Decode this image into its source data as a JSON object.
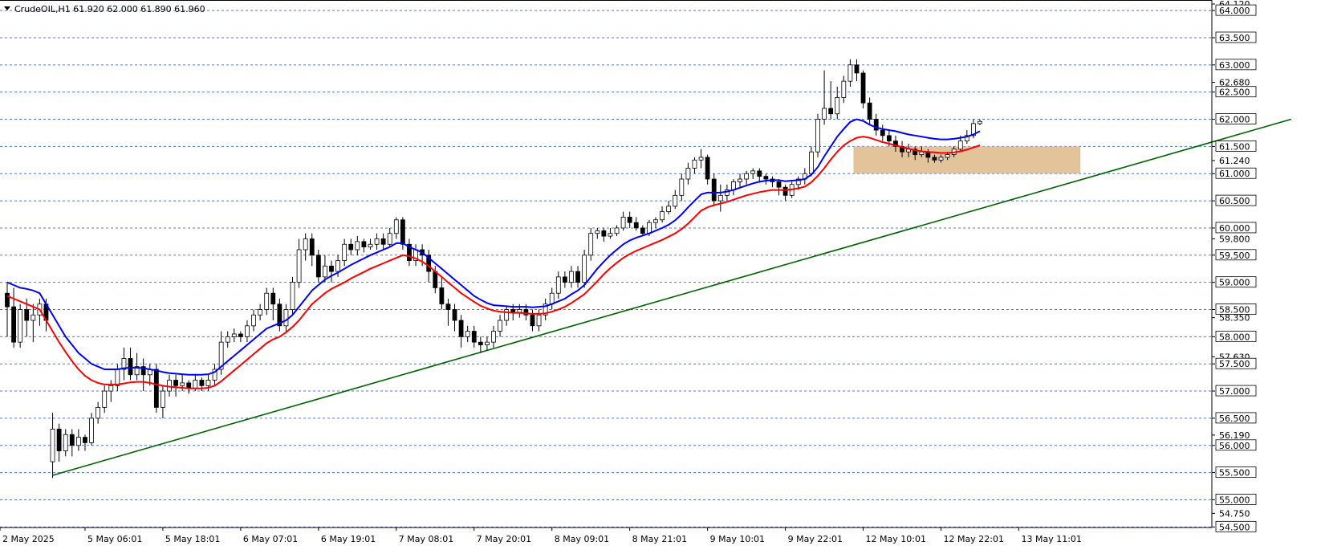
{
  "chart_title": "CrudeOIL,H1  61.920 62.000 61.890 61.960",
  "colors": {
    "background": "#ffffff",
    "axis": "#000000",
    "grid_dashed": "#3b5fc7",
    "candle_up_fill": "#ffffff",
    "candle_down_fill": "#000000",
    "ma_fast": "#0000ff",
    "ma_slow": "#ff0000",
    "trendline": "#006400",
    "zone": "#deb887"
  },
  "chart_data": {
    "type": "candlestick",
    "instrument": "CrudeOIL",
    "timeframe": "H1",
    "ohlc_last": {
      "open": 61.92,
      "high": 62.0,
      "low": 61.89,
      "close": 61.96
    },
    "ylim": [
      54.49,
      64.12
    ],
    "y_ticks": [
      {
        "label": "64.120",
        "value": 64.12
      },
      {
        "label": "64.000",
        "value": 64.0
      },
      {
        "label": "63.500",
        "value": 63.5
      },
      {
        "label": "63.000",
        "value": 63.0
      },
      {
        "label": "62.680",
        "value": 62.68
      },
      {
        "label": "62.500",
        "value": 62.5
      },
      {
        "label": "62.000",
        "value": 62.0
      },
      {
        "label": "61.500",
        "value": 61.5
      },
      {
        "label": "61.240",
        "value": 61.24
      },
      {
        "label": "61.000",
        "value": 61.0
      },
      {
        "label": "60.500",
        "value": 60.5
      },
      {
        "label": "60.000",
        "value": 60.0
      },
      {
        "label": "59.800",
        "value": 59.8
      },
      {
        "label": "59.500",
        "value": 59.5
      },
      {
        "label": "59.000",
        "value": 59.0
      },
      {
        "label": "58.500",
        "value": 58.5
      },
      {
        "label": "58.350",
        "value": 58.35
      },
      {
        "label": "58.000",
        "value": 58.0
      },
      {
        "label": "57.630",
        "value": 57.63
      },
      {
        "label": "57.500",
        "value": 57.5
      },
      {
        "label": "57.000",
        "value": 57.0
      },
      {
        "label": "56.500",
        "value": 56.5
      },
      {
        "label": "56.190",
        "value": 56.19
      },
      {
        "label": "56.000",
        "value": 56.0
      },
      {
        "label": "55.500",
        "value": 55.5
      },
      {
        "label": "55.000",
        "value": 55.0
      },
      {
        "label": "54.750",
        "value": 54.75
      },
      {
        "label": "54.500",
        "value": 54.5
      }
    ],
    "boxed_levels": [
      64.0,
      63.5,
      63.0,
      62.5,
      62.0,
      61.5,
      61.0,
      60.5,
      60.0,
      59.5,
      59.0,
      58.5,
      58.0,
      57.5,
      57.0,
      56.5,
      56.0,
      55.5,
      55.0,
      54.5
    ],
    "x_ticks": [
      {
        "label": "2 May 2025",
        "bar": 0
      },
      {
        "label": "5 May 06:01",
        "bar": 12
      },
      {
        "label": "5 May 18:01",
        "bar": 24
      },
      {
        "label": "6 May 07:01",
        "bar": 36
      },
      {
        "label": "6 May 19:01",
        "bar": 48
      },
      {
        "label": "7 May 08:01",
        "bar": 60
      },
      {
        "label": "7 May 20:01",
        "bar": 72
      },
      {
        "label": "8 May 09:01",
        "bar": 84
      },
      {
        "label": "8 May 21:01",
        "bar": 96
      },
      {
        "label": "9 May 10:01",
        "bar": 108
      },
      {
        "label": "9 May 22:01",
        "bar": 120
      },
      {
        "label": "12 May 10:01",
        "bar": 132
      },
      {
        "label": "12 May 22:01",
        "bar": 144
      },
      {
        "label": "13 May 11:01",
        "bar": 156
      }
    ],
    "candles": [
      [
        58.8,
        58.55,
        59.0,
        58.0
      ],
      [
        58.55,
        57.9,
        58.9,
        57.8
      ],
      [
        57.9,
        58.5,
        58.6,
        57.8
      ],
      [
        58.5,
        58.3,
        58.7,
        58.0
      ],
      [
        58.3,
        58.4,
        58.6,
        57.9
      ],
      [
        58.4,
        58.6,
        58.7,
        58.2
      ],
      [
        58.6,
        58.3,
        58.7,
        58.1
      ],
      [
        55.7,
        56.3,
        56.6,
        55.4
      ],
      [
        56.3,
        55.9,
        56.4,
        55.7
      ],
      [
        55.9,
        56.2,
        56.3,
        55.8
      ],
      [
        56.2,
        56.0,
        56.3,
        55.8
      ],
      [
        56.0,
        56.15,
        56.3,
        55.9
      ],
      [
        56.15,
        56.05,
        56.2,
        55.9
      ],
      [
        56.05,
        56.5,
        56.6,
        56.0
      ],
      [
        56.5,
        56.7,
        56.8,
        56.4
      ],
      [
        56.7,
        57.0,
        57.1,
        56.6
      ],
      [
        57.0,
        57.1,
        57.2,
        56.8
      ],
      [
        57.1,
        57.4,
        57.5,
        57.0
      ],
      [
        57.4,
        57.6,
        57.8,
        57.2
      ],
      [
        57.6,
        57.3,
        57.8,
        57.2
      ],
      [
        57.3,
        57.45,
        57.7,
        57.2
      ],
      [
        57.45,
        57.3,
        57.6,
        57.0
      ],
      [
        57.3,
        57.4,
        57.5,
        57.1
      ],
      [
        57.4,
        56.7,
        57.5,
        56.6
      ],
      [
        56.7,
        57.0,
        57.1,
        56.5
      ],
      [
        57.0,
        57.2,
        57.3,
        56.9
      ],
      [
        57.2,
        57.1,
        57.3,
        56.9
      ],
      [
        57.1,
        57.15,
        57.3,
        57.0
      ],
      [
        57.15,
        57.05,
        57.2,
        56.95
      ],
      [
        57.05,
        57.2,
        57.3,
        57.0
      ],
      [
        57.2,
        57.1,
        57.25,
        57.0
      ],
      [
        57.1,
        57.2,
        57.3,
        57.0
      ],
      [
        57.2,
        57.4,
        57.5,
        57.1
      ],
      [
        57.4,
        57.9,
        58.1,
        57.3
      ],
      [
        57.9,
        58.0,
        58.1,
        57.8
      ],
      [
        58.0,
        58.05,
        58.15,
        57.9
      ],
      [
        58.05,
        58.0,
        58.1,
        57.9
      ],
      [
        58.0,
        58.2,
        58.3,
        57.9
      ],
      [
        58.2,
        58.4,
        58.5,
        58.1
      ],
      [
        58.4,
        58.5,
        58.6,
        58.3
      ],
      [
        58.5,
        58.8,
        58.9,
        58.4
      ],
      [
        58.8,
        58.6,
        58.9,
        58.3
      ],
      [
        58.6,
        58.2,
        58.7,
        58.1
      ],
      [
        58.2,
        58.5,
        58.6,
        58.1
      ],
      [
        58.5,
        59.0,
        59.1,
        58.4
      ],
      [
        59.0,
        59.6,
        59.8,
        58.9
      ],
      [
        59.6,
        59.8,
        59.9,
        59.4
      ],
      [
        59.8,
        59.5,
        59.9,
        59.3
      ],
      [
        59.5,
        59.1,
        59.6,
        59.0
      ],
      [
        59.1,
        59.3,
        59.5,
        59.0
      ],
      [
        59.3,
        59.2,
        59.4,
        59.0
      ],
      [
        59.2,
        59.4,
        59.5,
        59.1
      ],
      [
        59.4,
        59.7,
        59.8,
        59.3
      ],
      [
        59.7,
        59.6,
        59.8,
        59.5
      ],
      [
        59.6,
        59.75,
        59.85,
        59.5
      ],
      [
        59.75,
        59.65,
        59.8,
        59.55
      ],
      [
        59.65,
        59.7,
        59.8,
        59.6
      ],
      [
        59.7,
        59.8,
        59.9,
        59.6
      ],
      [
        59.8,
        59.7,
        59.9,
        59.6
      ],
      [
        59.7,
        59.9,
        60.0,
        59.65
      ],
      [
        59.9,
        60.15,
        60.2,
        59.8
      ],
      [
        60.15,
        59.7,
        60.2,
        59.6
      ],
      [
        59.7,
        59.4,
        59.8,
        59.3
      ],
      [
        59.4,
        59.6,
        59.7,
        59.3
      ],
      [
        59.6,
        59.5,
        59.7,
        59.3
      ],
      [
        59.5,
        59.2,
        59.6,
        59.0
      ],
      [
        59.2,
        58.9,
        59.3,
        58.8
      ],
      [
        58.9,
        58.6,
        59.1,
        58.5
      ],
      [
        58.6,
        58.5,
        58.7,
        58.2
      ],
      [
        58.5,
        58.3,
        58.6,
        58.1
      ],
      [
        58.3,
        58.0,
        58.4,
        57.8
      ],
      [
        58.0,
        58.1,
        58.2,
        57.9
      ],
      [
        58.1,
        57.9,
        58.2,
        57.8
      ],
      [
        57.9,
        57.85,
        58.0,
        57.7
      ],
      [
        57.85,
        57.9,
        58.0,
        57.75
      ],
      [
        57.9,
        58.1,
        58.2,
        57.8
      ],
      [
        58.1,
        58.3,
        58.4,
        58.0
      ],
      [
        58.3,
        58.5,
        58.55,
        58.2
      ],
      [
        58.5,
        58.45,
        58.6,
        58.3
      ],
      [
        58.45,
        58.5,
        58.6,
        58.35
      ],
      [
        58.5,
        58.4,
        58.6,
        58.3
      ],
      [
        58.4,
        58.2,
        58.5,
        58.1
      ],
      [
        58.2,
        58.4,
        58.5,
        58.1
      ],
      [
        58.4,
        58.6,
        58.7,
        58.3
      ],
      [
        58.6,
        58.8,
        58.9,
        58.5
      ],
      [
        58.8,
        59.1,
        59.2,
        58.7
      ],
      [
        59.1,
        59.0,
        59.2,
        58.9
      ],
      [
        59.0,
        59.2,
        59.3,
        58.9
      ],
      [
        59.2,
        59.0,
        59.3,
        58.9
      ],
      [
        59.0,
        59.5,
        59.6,
        58.9
      ],
      [
        59.5,
        59.9,
        60.0,
        59.4
      ],
      [
        59.9,
        59.95,
        60.0,
        59.8
      ],
      [
        59.95,
        59.85,
        60.0,
        59.75
      ],
      [
        59.85,
        59.9,
        60.0,
        59.8
      ],
      [
        59.9,
        60.0,
        60.05,
        59.85
      ],
      [
        60.0,
        60.2,
        60.3,
        59.95
      ],
      [
        60.2,
        60.1,
        60.3,
        60.0
      ],
      [
        60.1,
        60.0,
        60.2,
        59.95
      ],
      [
        60.0,
        59.9,
        60.05,
        59.85
      ],
      [
        59.9,
        60.1,
        60.15,
        59.85
      ],
      [
        60.1,
        60.15,
        60.2,
        60.0
      ],
      [
        60.15,
        60.3,
        60.4,
        60.1
      ],
      [
        60.3,
        60.4,
        60.5,
        60.25
      ],
      [
        60.4,
        60.6,
        60.7,
        60.35
      ],
      [
        60.6,
        60.9,
        61.0,
        60.5
      ],
      [
        60.9,
        61.1,
        61.2,
        60.8
      ],
      [
        61.1,
        61.25,
        61.3,
        61.0
      ],
      [
        61.25,
        61.3,
        61.45,
        61.1
      ],
      [
        61.3,
        60.9,
        61.35,
        60.8
      ],
      [
        60.9,
        60.5,
        61.0,
        60.4
      ],
      [
        60.5,
        60.6,
        60.8,
        60.3
      ],
      [
        60.6,
        60.7,
        60.8,
        60.5
      ],
      [
        60.7,
        60.85,
        60.9,
        60.6
      ],
      [
        60.85,
        60.9,
        61.0,
        60.75
      ],
      [
        60.9,
        61.0,
        61.05,
        60.8
      ],
      [
        61.0,
        61.05,
        61.1,
        60.9
      ],
      [
        61.05,
        60.95,
        61.1,
        60.85
      ],
      [
        60.95,
        60.9,
        61.0,
        60.8
      ],
      [
        60.9,
        60.85,
        60.95,
        60.75
      ],
      [
        60.85,
        60.75,
        60.9,
        60.6
      ],
      [
        60.75,
        60.6,
        60.8,
        60.5
      ],
      [
        60.6,
        60.8,
        60.85,
        60.55
      ],
      [
        60.8,
        60.9,
        60.95,
        60.7
      ],
      [
        60.9,
        61.0,
        61.1,
        60.8
      ],
      [
        61.0,
        61.4,
        61.5,
        60.95
      ],
      [
        61.4,
        62.0,
        62.1,
        61.3
      ],
      [
        62.0,
        62.2,
        62.9,
        61.9
      ],
      [
        62.2,
        62.1,
        62.7,
        62.0
      ],
      [
        62.1,
        62.4,
        62.6,
        62.0
      ],
      [
        62.4,
        62.7,
        62.8,
        62.3
      ],
      [
        62.7,
        63.0,
        63.1,
        62.6
      ],
      [
        63.0,
        62.85,
        63.1,
        62.7
      ],
      [
        62.85,
        62.3,
        62.9,
        62.2
      ],
      [
        62.3,
        62.0,
        62.4,
        61.9
      ],
      [
        62.0,
        61.8,
        62.1,
        61.7
      ],
      [
        61.8,
        61.7,
        61.9,
        61.6
      ],
      [
        61.7,
        61.6,
        61.8,
        61.5
      ],
      [
        61.6,
        61.5,
        61.7,
        61.4
      ],
      [
        61.5,
        61.4,
        61.6,
        61.3
      ],
      [
        61.4,
        61.45,
        61.55,
        61.3
      ],
      [
        61.45,
        61.35,
        61.5,
        61.25
      ],
      [
        61.35,
        61.4,
        61.5,
        61.3
      ],
      [
        61.4,
        61.3,
        61.45,
        61.2
      ],
      [
        61.3,
        61.25,
        61.35,
        61.2
      ],
      [
        61.25,
        61.3,
        61.35,
        61.2
      ],
      [
        61.3,
        61.35,
        61.4,
        61.25
      ],
      [
        61.35,
        61.45,
        61.5,
        61.3
      ],
      [
        61.45,
        61.6,
        61.7,
        61.4
      ],
      [
        61.6,
        61.7,
        61.8,
        61.55
      ],
      [
        61.7,
        61.92,
        62.0,
        61.65
      ],
      [
        61.92,
        61.96,
        62.0,
        61.89
      ]
    ],
    "ma_fast_values": [
      59.0,
      58.95,
      58.9,
      58.88,
      58.85,
      58.8,
      58.6,
      58.4,
      58.2,
      58.0,
      57.85,
      57.7,
      57.6,
      57.5,
      57.45,
      57.4,
      57.4,
      57.4,
      57.42,
      57.43,
      57.43,
      57.42,
      57.4,
      57.38,
      57.35,
      57.33,
      57.32,
      57.31,
      57.3,
      57.3,
      57.3,
      57.31,
      57.35,
      57.45,
      57.55,
      57.65,
      57.75,
      57.85,
      57.95,
      58.05,
      58.15,
      58.2,
      58.25,
      58.3,
      58.4,
      58.55,
      58.7,
      58.85,
      58.95,
      59.05,
      59.12,
      59.18,
      59.25,
      59.32,
      59.38,
      59.44,
      59.5,
      59.55,
      59.6,
      59.65,
      59.72,
      59.72,
      59.65,
      59.6,
      59.55,
      59.45,
      59.35,
      59.25,
      59.15,
      59.05,
      58.95,
      58.85,
      58.75,
      58.68,
      58.62,
      58.58,
      58.57,
      58.56,
      58.55,
      58.55,
      58.55,
      58.54,
      58.55,
      58.56,
      58.6,
      58.65,
      58.7,
      58.78,
      58.85,
      58.95,
      59.1,
      59.25,
      59.38,
      59.5,
      59.6,
      59.7,
      59.77,
      59.82,
      59.86,
      59.9,
      59.95,
      60.0,
      60.06,
      60.14,
      60.25,
      60.38,
      60.5,
      60.62,
      60.65,
      60.65,
      60.65,
      60.67,
      60.7,
      60.74,
      60.78,
      60.82,
      60.85,
      60.87,
      60.88,
      60.88,
      60.86,
      60.87,
      60.88,
      60.9,
      60.98,
      61.12,
      61.32,
      61.5,
      61.68,
      61.82,
      61.95,
      62.0,
      61.97,
      61.9,
      61.85,
      61.82,
      61.8,
      61.78,
      61.75,
      61.72,
      61.7,
      61.68,
      61.66,
      61.64,
      61.63,
      61.63,
      61.64,
      61.66,
      61.68,
      61.72,
      61.78
    ],
    "ma_slow_values": [
      58.75,
      58.7,
      58.65,
      58.6,
      58.55,
      58.5,
      58.3,
      58.1,
      57.9,
      57.72,
      57.55,
      57.4,
      57.28,
      57.2,
      57.15,
      57.12,
      57.12,
      57.12,
      57.14,
      57.16,
      57.17,
      57.17,
      57.15,
      57.12,
      57.1,
      57.08,
      57.07,
      57.06,
      57.05,
      57.05,
      57.05,
      57.06,
      57.1,
      57.18,
      57.28,
      57.38,
      57.48,
      57.58,
      57.68,
      57.78,
      57.88,
      57.95,
      58.0,
      58.08,
      58.18,
      58.3,
      58.45,
      58.6,
      58.7,
      58.8,
      58.88,
      58.94,
      59.0,
      59.07,
      59.13,
      59.19,
      59.25,
      59.3,
      59.35,
      59.4,
      59.45,
      59.5,
      59.48,
      59.44,
      59.38,
      59.3,
      59.2,
      59.1,
      59.0,
      58.9,
      58.8,
      58.72,
      58.64,
      58.57,
      58.52,
      58.48,
      58.46,
      58.45,
      58.44,
      58.44,
      58.43,
      58.42,
      58.42,
      58.43,
      58.46,
      58.5,
      58.55,
      58.62,
      58.7,
      58.78,
      58.9,
      59.02,
      59.15,
      59.26,
      59.36,
      59.45,
      59.52,
      59.58,
      59.63,
      59.68,
      59.73,
      59.78,
      59.84,
      59.9,
      59.98,
      60.08,
      60.2,
      60.32,
      60.38,
      60.42,
      60.45,
      60.48,
      60.52,
      60.56,
      60.6,
      60.63,
      60.66,
      60.68,
      60.7,
      60.7,
      60.7,
      60.71,
      60.73,
      60.76,
      60.84,
      60.96,
      61.1,
      61.26,
      61.4,
      61.52,
      61.6,
      61.66,
      61.68,
      61.66,
      61.62,
      61.58,
      61.55,
      61.52,
      61.49,
      61.46,
      61.43,
      61.41,
      61.4,
      61.39,
      61.38,
      61.38,
      61.39,
      61.41,
      61.44,
      61.48,
      61.52
    ],
    "zone": {
      "low": 61.0,
      "high": 61.5,
      "from_bar": 131,
      "to_bar": 165
    },
    "trendline": {
      "p1": {
        "bar": 7,
        "price": 55.45
      },
      "p2": {
        "bar": 198,
        "price": 62.0
      }
    }
  }
}
